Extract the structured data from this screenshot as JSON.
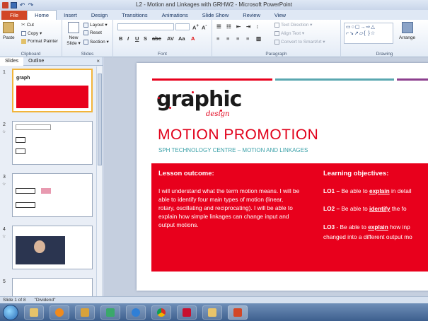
{
  "window": {
    "title": "L2 - Motion and Linkages with GRHW2  -  Microsoft PowerPoint"
  },
  "ribbon_tabs": [
    "File",
    "Home",
    "Insert",
    "Design",
    "Transitions",
    "Animations",
    "Slide Show",
    "Review",
    "View"
  ],
  "ribbon": {
    "clipboard": {
      "paste": "Paste",
      "cut": "Cut",
      "copy": "Copy ▾",
      "format_painter": "Format Painter",
      "label": "Clipboard"
    },
    "slides": {
      "new_slide": "New Slide ▾",
      "layout": "Layout ▾",
      "reset": "Reset",
      "section": "Section ▾",
      "label": "Slides"
    },
    "font": {
      "label": "Font"
    },
    "paragraph": {
      "text_direction": "Text Direction ▾",
      "align_text": "Align Text ▾",
      "convert_smartart": "Convert to SmartArt ▾",
      "label": "Paragraph"
    },
    "drawing": {
      "arrange": "Arrange",
      "label": "Drawing"
    }
  },
  "left_pane": {
    "tabs": [
      "Slides",
      "Outline"
    ],
    "close": "×",
    "thumbnails": [
      {
        "num": "1"
      },
      {
        "num": "2"
      },
      {
        "num": "3"
      },
      {
        "num": "4"
      },
      {
        "num": "5"
      }
    ]
  },
  "slide": {
    "logo": "graphic",
    "logo_sub": "design",
    "title": "MOTION PROMOTION",
    "subtitle": "SPH TECHNOLOGY CENTRE – MOTION AND LINKAGES",
    "lesson_heading": "Lesson outcome:",
    "lesson_text": "I will understand what the term motion means. I will be able to identify four main types of motion (linear, rotary, oscillating and reciprocating). I will be able to explain how simple linkages can change input and output motions.",
    "objectives_heading": "Learning objectives:",
    "objectives": [
      {
        "prefix": "LO1 –",
        "pre": " Be able to ",
        "key": "explain",
        "post": " in detail"
      },
      {
        "prefix": "LO2 –",
        "pre": " Be able to ",
        "key": "identify",
        "post": "  the fo"
      },
      {
        "prefix": "LO3",
        "pre": " - Be able to ",
        "key": "explain",
        "post": " how inp"
      }
    ],
    "objective_cont": "changed into a different output mo",
    "colors": {
      "accent_red": "#e8001c",
      "teal": "#3aa0a8"
    }
  },
  "status": {
    "slide_info": "Slide 1 of 8",
    "theme": "\"Dividend\""
  },
  "taskbar": [
    "start",
    "explorer",
    "media-player",
    "media-player-2",
    "powerpoint",
    "internet-explorer",
    "chrome",
    "adobe-reader",
    "folder",
    "powerpoint-active"
  ]
}
